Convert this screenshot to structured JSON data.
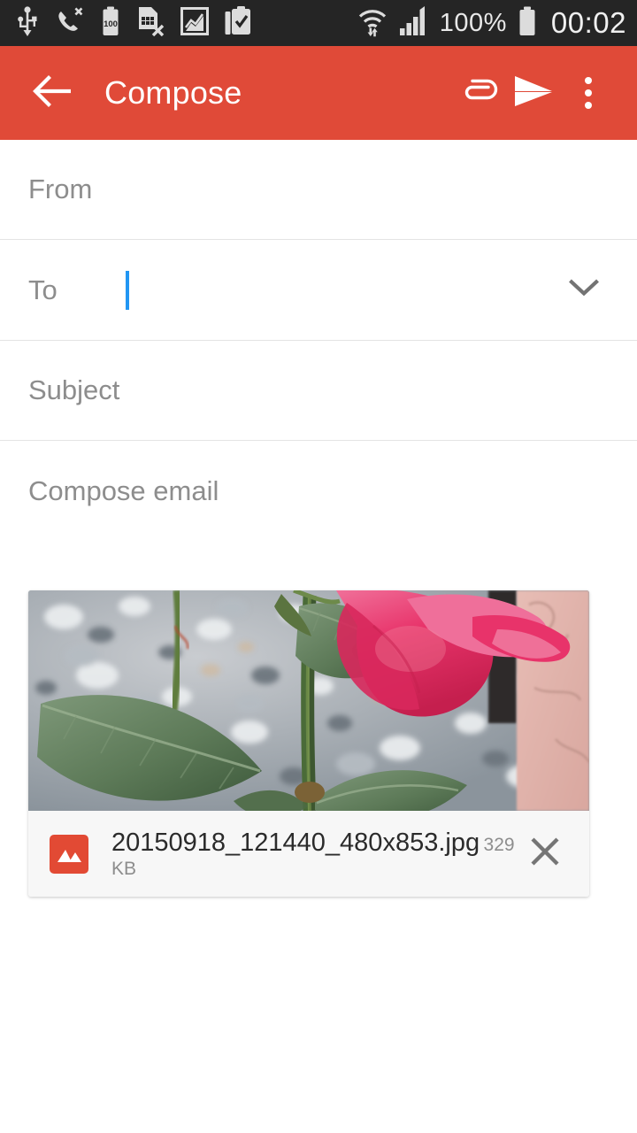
{
  "status_bar": {
    "icons": [
      "usb-icon",
      "missed-call-icon",
      "battery-100-icon",
      "sim-card-error-icon",
      "picture-icon",
      "clipboard-check-icon"
    ],
    "battery_percent": "100%",
    "wifi_icon": "wifi-transfer-icon",
    "signal_icon": "cellular-signal-icon",
    "battery_icon": "battery-full-icon",
    "clock": "00:02",
    "background": "#252525",
    "foreground": "#e8e8e8"
  },
  "app_bar": {
    "title": "Compose",
    "back_icon": "back-arrow-icon",
    "attach_icon": "paperclip-icon",
    "send_icon": "send-icon",
    "overflow_icon": "overflow-menu-icon",
    "background": "#e04a38",
    "foreground": "#ffffff"
  },
  "form": {
    "from": {
      "label": "From",
      "value": ""
    },
    "to": {
      "label": "To",
      "value": "",
      "expand_icon": "chevron-down-icon",
      "caret_color": "#2196f3"
    },
    "subject": {
      "label": "Subject",
      "value": ""
    },
    "body": {
      "placeholder": "Compose email",
      "value": ""
    }
  },
  "attachment": {
    "file_icon": "image-file-icon",
    "file_name": "20150918_121440_480x853.jpg",
    "file_size": "329 KB",
    "remove_icon": "close-icon",
    "preview_alt": "photo of a pink rose flower with green leaves over gravel",
    "accent": "#e24a34"
  }
}
